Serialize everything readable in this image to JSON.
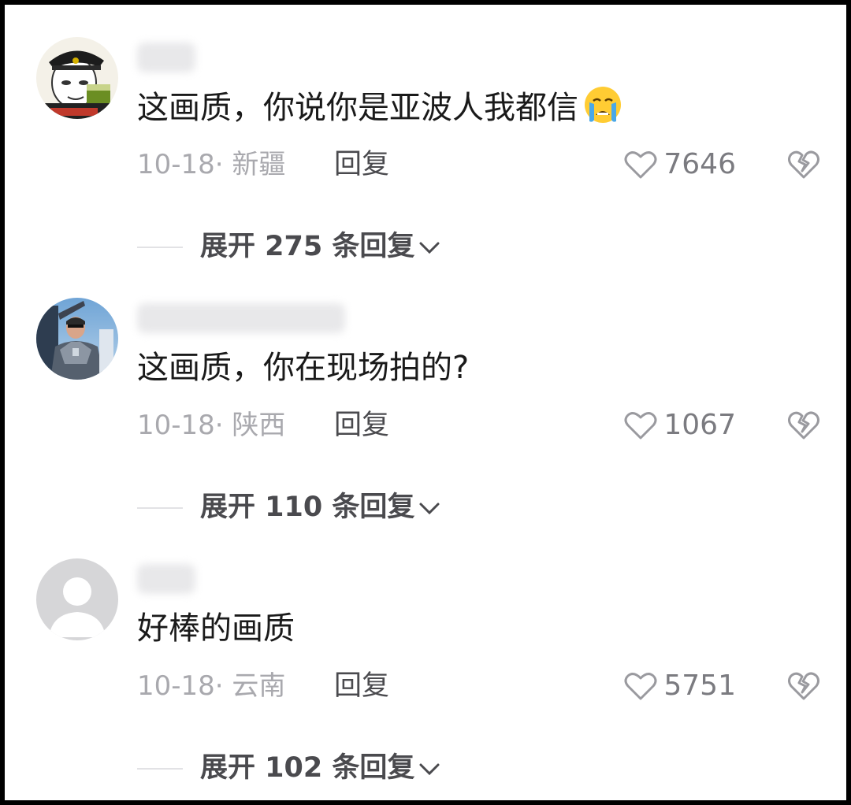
{
  "comments": [
    {
      "avatar": "avatar-police-cap-cartoon",
      "content": "这画质，你说你是亚波人我都信",
      "emoji": "crying-face-emoji",
      "date": "10-18",
      "location": "新疆",
      "reply_label": "回复",
      "likes": "7646",
      "expand_label": "展开 275 条回复"
    },
    {
      "avatar": "avatar-armored-man-photo",
      "content": "这画质，你在现场拍的?",
      "date": "10-18",
      "location": "陕西",
      "reply_label": "回复",
      "likes": "1067",
      "expand_label": "展开 110 条回复"
    },
    {
      "avatar": "avatar-default-person",
      "content": "好棒的画质",
      "date": "10-18",
      "location": "云南",
      "reply_label": "回复",
      "likes": "5751",
      "expand_label": "展开 102 条回复"
    }
  ],
  "icons": {
    "like": "heart-outline-icon",
    "dislike": "broken-heart-icon",
    "expand": "chevron-down-icon"
  },
  "colors": {
    "text_primary": "#1a1a1a",
    "text_meta": "#a9a9ae",
    "text_action": "#4a4a4e"
  }
}
